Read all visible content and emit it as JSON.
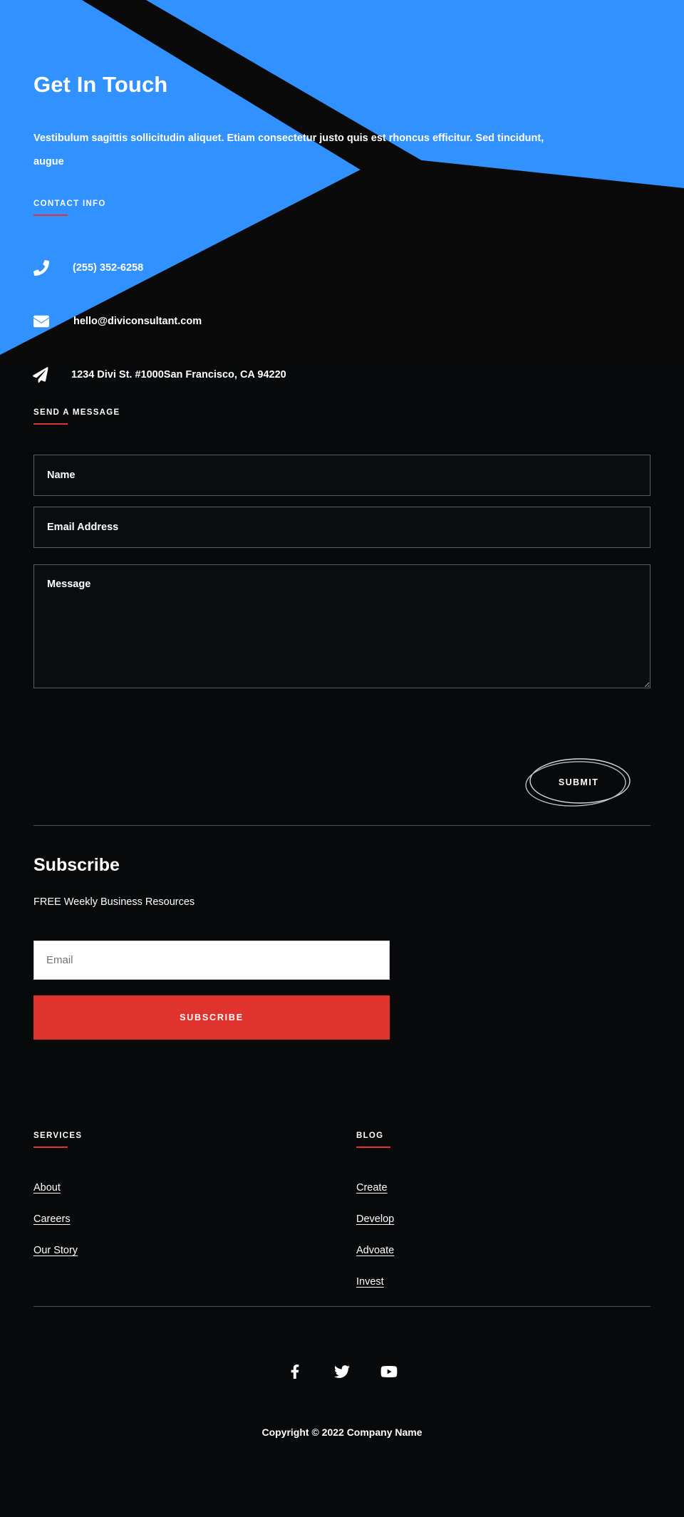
{
  "theme": {
    "blue": "#3091ff",
    "red": "#e0332e",
    "dark": "#07090b",
    "text": "#ffffff"
  },
  "hero": {
    "title": "Get In Touch",
    "intro": "Vestibulum sagittis sollicitudin aliquet. Etiam consectetur justo quis est rhoncus efficitur. Sed tincidunt, augue",
    "contact_label": "CONTACT INFO",
    "contacts": [
      {
        "icon": "phone-icon",
        "value": "(255) 352-6258"
      },
      {
        "icon": "envelope-icon",
        "value": "hello@diviconsultant.com"
      },
      {
        "icon": "paper-plane-icon",
        "value": "1234 Divi St. #1000San Francisco, CA 94220"
      }
    ]
  },
  "message_form": {
    "label": "SEND A MESSAGE",
    "name_placeholder": "Name",
    "name_value": "",
    "email_placeholder": "Email Address",
    "email_value": "",
    "message_placeholder": "Message",
    "message_value": "",
    "submit_label": "SUBMIT"
  },
  "subscribe": {
    "title": "Subscribe",
    "subtitle": "FREE Weekly Business Resources",
    "email_placeholder": "Email",
    "email_value": "",
    "button_label": "SUBSCRIBE"
  },
  "footer": {
    "columns": [
      {
        "heading": "SERVICES",
        "links": [
          "About",
          "Careers",
          "Our Story"
        ]
      },
      {
        "heading": "BLOG",
        "links": [
          "Create",
          "Develop",
          "Advoate",
          "Invest"
        ]
      }
    ],
    "social": [
      {
        "name": "facebook-icon",
        "label": "Facebook"
      },
      {
        "name": "twitter-icon",
        "label": "Twitter"
      },
      {
        "name": "youtube-icon",
        "label": "YouTube"
      }
    ],
    "copyright": "Copyright © 2022 Company Name"
  }
}
